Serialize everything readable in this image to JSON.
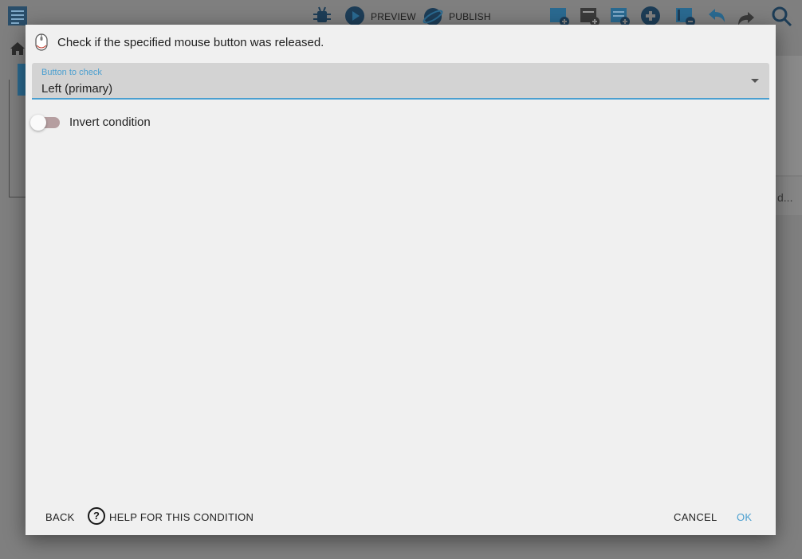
{
  "toolbar": {
    "preview_label": "PREVIEW",
    "publish_label": "PUBLISH",
    "icons": [
      "events-list-icon",
      "debug-icon",
      "preview-play-icon",
      "publish-icon",
      "add-event-icon",
      "add-external-event-icon",
      "add-instruction-icon",
      "add-subevent-icon",
      "add-comment-icon",
      "undo-icon",
      "redo-icon",
      "search-icon"
    ]
  },
  "background": {
    "truncated_text": "d..."
  },
  "dialog": {
    "title": "Check if the specified mouse button was released.",
    "icon": "mouse-icon",
    "select": {
      "label": "Button to check",
      "value": "Left (primary)"
    },
    "toggle": {
      "label": "Invert condition",
      "checked": false
    },
    "buttons": {
      "back": "BACK",
      "help": "HELP FOR THIS CONDITION",
      "cancel": "CANCEL",
      "ok": "OK"
    }
  },
  "colors": {
    "accent": "#4a9fd0",
    "dialog_bg": "#f0f0f0",
    "select_bg": "#d3d3d3",
    "toggle_track": "#b59ea0",
    "overlay": "#7f7f7f"
  }
}
